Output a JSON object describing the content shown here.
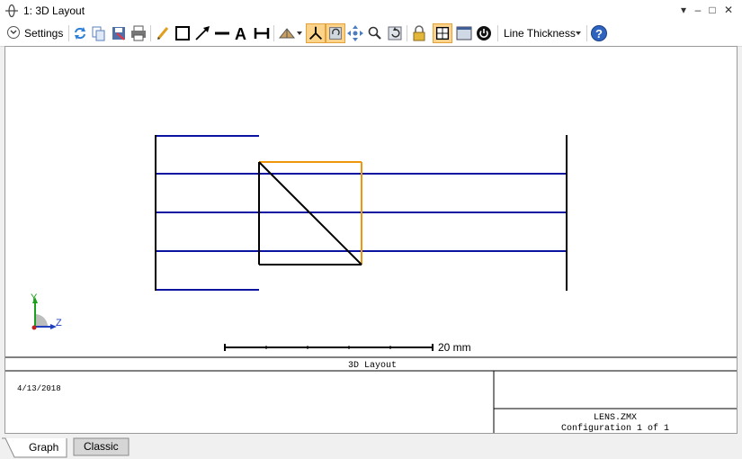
{
  "window": {
    "title": "1: 3D Layout"
  },
  "toolbar": {
    "settings_label": "Settings",
    "line_thickness_label": "Line Thickness",
    "icons": [
      "refresh-icon",
      "copy-icon",
      "save-icon",
      "print-icon",
      "pencil-icon",
      "rectangle-icon",
      "arrow-icon",
      "line-icon",
      "text-icon",
      "dimension-icon",
      "rotate-view-icon",
      "axes-icon",
      "auto-rotate-icon",
      "pan-icon",
      "zoom-icon",
      "reset-view-icon",
      "lock-icon",
      "fit-icon",
      "window-icon",
      "power-icon",
      "help-icon"
    ]
  },
  "plot": {
    "axis_y_label": "Y",
    "axis_z_label": "Z",
    "scale_label": "20 mm",
    "ray_color": "#0a14a0",
    "element_color": "#000000",
    "highlight_color": "#f0960a"
  },
  "info": {
    "title": "3D Layout",
    "date": "4/13/2018",
    "file": "LENS.ZMX",
    "configuration": "Configuration 1 of 1"
  },
  "tabs": [
    {
      "label": "Graph",
      "active": true
    },
    {
      "label": "Classic",
      "active": false
    }
  ]
}
